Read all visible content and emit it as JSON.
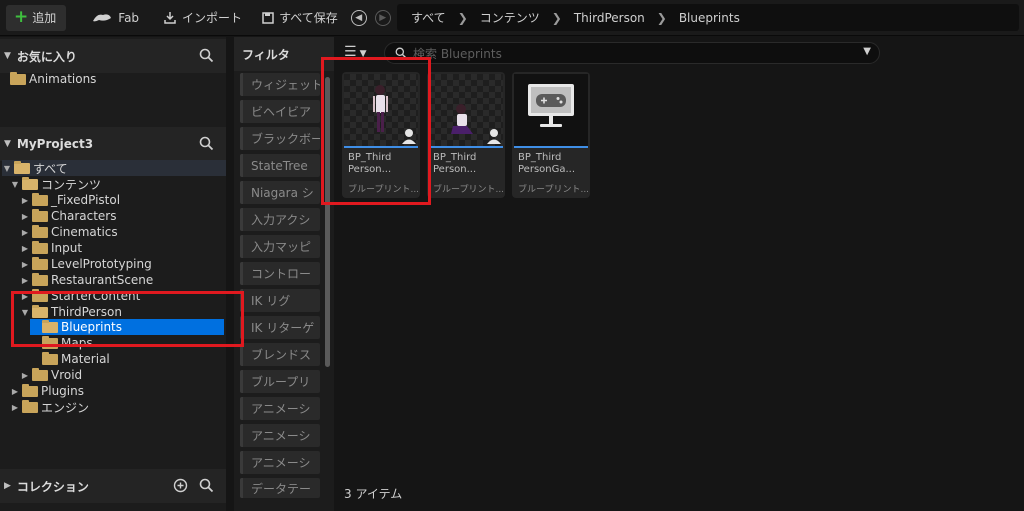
{
  "toolbar": {
    "add_label": "追加",
    "fab_label": "Fab",
    "import_label": "インポート",
    "save_all_label": "すべて保存"
  },
  "breadcrumb": [
    "すべて",
    "コンテンツ",
    "ThirdPerson",
    "Blueprints"
  ],
  "favorites": {
    "title": "お気に入り",
    "items": [
      "Animations"
    ]
  },
  "project": {
    "title": "MyProject3",
    "tree": [
      {
        "label": "すべて"
      },
      {
        "label": "コンテンツ"
      },
      {
        "label": "_FixedPistol"
      },
      {
        "label": "Characters"
      },
      {
        "label": "Cinematics"
      },
      {
        "label": "Input"
      },
      {
        "label": "LevelPrototyping"
      },
      {
        "label": "RestaurantScene"
      },
      {
        "label": "StarterContent"
      },
      {
        "label": "ThirdPerson"
      },
      {
        "label": "Blueprints"
      },
      {
        "label": "Maps"
      },
      {
        "label": "Material"
      },
      {
        "label": "Vroid"
      },
      {
        "label": "Plugins"
      },
      {
        "label": "エンジン"
      }
    ]
  },
  "collections": {
    "title": "コレクション"
  },
  "filters": {
    "title": "フィルタ",
    "items": [
      "ウィジェット",
      "ビヘイビア",
      "ブラックボー",
      "StateTree",
      "Niagara シ",
      "入力アクシ",
      "入力マッピ",
      "コントロー",
      "IK リグ",
      "IK リターゲ",
      "ブレンドス",
      "ブループリ",
      "アニメーシ",
      "アニメーシ",
      "アニメーシ",
      "データテー"
    ]
  },
  "search": {
    "placeholder": "検索 Blueprints"
  },
  "assets": [
    {
      "name": "BP_Third\nPerson...",
      "type": "ブループリント..."
    },
    {
      "name": "BP_Third\nPerson...",
      "type": "ブループリント..."
    },
    {
      "name": "BP_Third\nPersonGa...",
      "type": "ブループリント..."
    }
  ],
  "status": {
    "item_count": "3 アイテム"
  },
  "colors": {
    "accent": "#0070e0",
    "highlight": "#e0191f",
    "add_plus": "#3fbf3f"
  }
}
